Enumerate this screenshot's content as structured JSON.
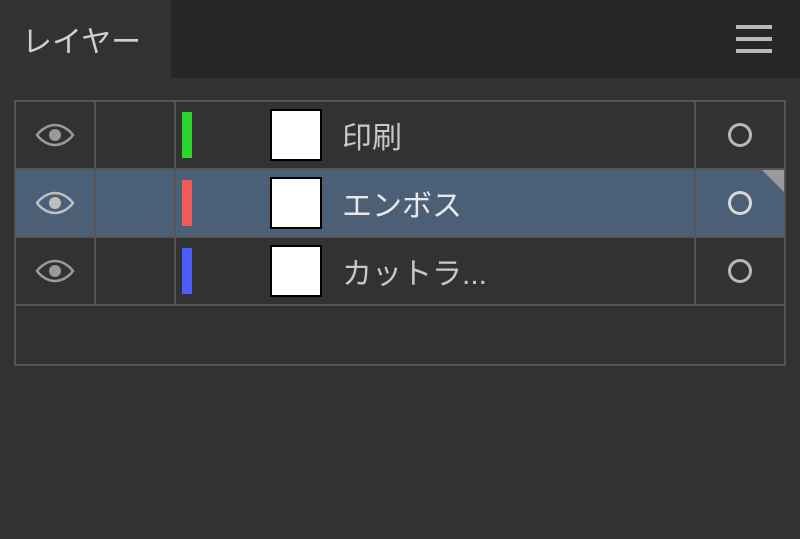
{
  "panel": {
    "title": "レイヤー"
  },
  "layers": [
    {
      "name": "印刷",
      "color": "#2dd52d",
      "visible": true,
      "selected": false
    },
    {
      "name": "エンボス",
      "color": "#f25a5a",
      "visible": true,
      "selected": true
    },
    {
      "name": "カットラ...",
      "color": "#4a5dff",
      "visible": true,
      "selected": false
    }
  ]
}
